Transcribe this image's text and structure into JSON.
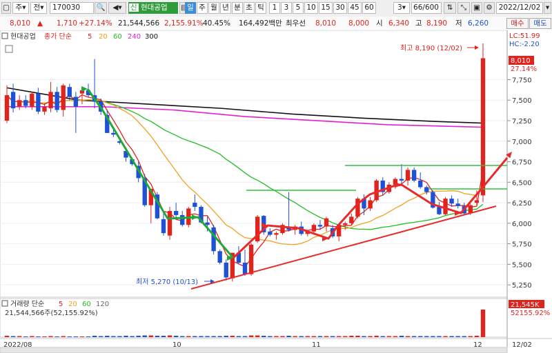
{
  "toolbar": {
    "period_label": "주",
    "all_label": "전",
    "code_value": "170030",
    "stock_name": "현대공업",
    "periods": [
      "일",
      "주",
      "월",
      "년",
      "분",
      "초",
      "틱"
    ],
    "intervals": [
      "1",
      "3",
      "5",
      "10",
      "15",
      "30",
      "45",
      "60"
    ],
    "interval_value": "3",
    "count_value": "66/600",
    "date_value": "2022/12/02"
  },
  "quote": {
    "price": "8,010",
    "arrow": "▲",
    "change": "1,710",
    "change_pct": "+27.14%",
    "volume": "21,544,566",
    "volume_ratio": "2,155.91%",
    "turnover_rate": "40.45%",
    "trade_value": "164,492백만",
    "best_ask_label": "최우선",
    "best_ask": "8,010",
    "best_bid": "8,000",
    "open_label": "시",
    "open": "6,340",
    "high_label": "고",
    "high": "8,190",
    "low_label": "저",
    "low": "6,260",
    "buy_label": "매수",
    "sell_label": "매도"
  },
  "price_legend": {
    "name": "현대공업",
    "type": "종가 단순",
    "ma": [
      {
        "label": "5",
        "color": "#e0231c"
      },
      {
        "label": "20",
        "color": "#f0a020"
      },
      {
        "label": "60",
        "color": "#1fbf1f"
      },
      {
        "label": "240",
        "color": "#e020d0"
      },
      {
        "label": "300",
        "color": "#111111"
      }
    ]
  },
  "corner": {
    "lc": "LC:51.99",
    "hc": "HC:-2.20"
  },
  "annotations": {
    "high": "최고 8,190 (12/02)",
    "low": "최저 5,270 (10/13)",
    "last_price": "8,010",
    "last_pct": "27.14%"
  },
  "volume_panel": {
    "title": "거래량 단순",
    "ma": [
      {
        "label": "5",
        "color": "#e0231c"
      },
      {
        "label": "20",
        "color": "#f0a020"
      },
      {
        "label": "60",
        "color": "#1fbf1f"
      },
      {
        "label": "120",
        "color": "#666666"
      }
    ],
    "current": "21,544,566주(52,155.92%)",
    "axis_value": "21,545K",
    "axis_pct": "52155.92%"
  },
  "x_axis": {
    "labels": [
      "2022/08",
      "10",
      "11",
      "12",
      "12/02"
    ]
  },
  "chart_data": {
    "type": "candlestick",
    "ylim": [
      5100,
      8350
    ],
    "y_ticks": [
      5250,
      5500,
      5750,
      6000,
      6250,
      6500,
      6750,
      7000,
      7250,
      7500,
      7750
    ],
    "y_tick_labels": [
      "5,250",
      "5,500",
      "5,750",
      "6,000",
      "6,250",
      "6,500",
      "6,750",
      "7,000",
      "7,250",
      "7,500",
      "7,750"
    ],
    "candles": [
      [
        7250,
        7680,
        7220,
        7560
      ],
      [
        7600,
        7700,
        7350,
        7400
      ],
      [
        7420,
        7560,
        7380,
        7500
      ],
      [
        7500,
        7560,
        7400,
        7430
      ],
      [
        7420,
        7600,
        7380,
        7580
      ],
      [
        7580,
        7650,
        7330,
        7360
      ],
      [
        7360,
        7460,
        7320,
        7420
      ],
      [
        7400,
        7720,
        7350,
        7600
      ],
      [
        7600,
        7660,
        7350,
        7380
      ],
      [
        7380,
        7700,
        7300,
        7680
      ],
      [
        7660,
        7700,
        7500,
        7540
      ],
      [
        7540,
        7600,
        7100,
        7420
      ],
      [
        7580,
        7650,
        7450,
        7620
      ],
      [
        7620,
        7700,
        7540,
        7560
      ],
      [
        7560,
        8000,
        7400,
        7480
      ],
      [
        7480,
        7520,
        7320,
        7360
      ],
      [
        7320,
        7380,
        7100,
        7100
      ],
      [
        7100,
        7150,
        7050,
        7080
      ],
      [
        7000,
        7040,
        6960,
        6980
      ],
      [
        6880,
        6900,
        6750,
        6800
      ],
      [
        6780,
        6800,
        6700,
        6720
      ],
      [
        6700,
        6750,
        6500,
        6550
      ],
      [
        6550,
        6600,
        6200,
        6220
      ],
      [
        6220,
        6400,
        6000,
        6420
      ],
      [
        6350,
        6380,
        6050,
        6060
      ],
      [
        6050,
        6120,
        5850,
        5880
      ],
      [
        5850,
        6200,
        5800,
        6150
      ],
      [
        6150,
        6250,
        6050,
        6100
      ],
      [
        6100,
        6150,
        5960,
        5980
      ],
      [
        5980,
        6200,
        5950,
        6180
      ],
      [
        6250,
        6350,
        6150,
        6200
      ],
      [
        6200,
        6220,
        6000,
        6010
      ],
      [
        6010,
        6080,
        5900,
        5980
      ],
      [
        5950,
        5980,
        5620,
        5660
      ],
      [
        5660,
        5680,
        5500,
        5520
      ],
      [
        5520,
        5560,
        5300,
        5340
      ],
      [
        5330,
        5640,
        5290,
        5640
      ],
      [
        5640,
        5720,
        5500,
        5520
      ],
      [
        5520,
        5680,
        5360,
        5380
      ],
      [
        5380,
        5760,
        5360,
        5740
      ],
      [
        5780,
        6100,
        5760,
        6080
      ],
      [
        6090,
        6100,
        5860,
        5890
      ],
      [
        5900,
        5940,
        5840,
        5860
      ],
      [
        5860,
        5900,
        5800,
        5880
      ],
      [
        5880,
        6000,
        5860,
        5980
      ],
      [
        5960,
        6380,
        5900,
        5920
      ],
      [
        5920,
        5980,
        5860,
        5960
      ],
      [
        5960,
        6020,
        5850,
        5870
      ],
      [
        5870,
        5920,
        5840,
        5900
      ],
      [
        5900,
        6000,
        5860,
        5980
      ],
      [
        5980,
        6040,
        5920,
        5960
      ],
      [
        5960,
        6080,
        5900,
        6060
      ],
      [
        5940,
        5980,
        5820,
        5840
      ],
      [
        5840,
        6000,
        5780,
        5980
      ],
      [
        5980,
        6020,
        5920,
        6000
      ],
      [
        6000,
        6120,
        5980,
        6080
      ],
      [
        6080,
        6320,
        6060,
        6300
      ],
      [
        6300,
        6350,
        6100,
        6180
      ],
      [
        6180,
        6320,
        6150,
        6280
      ],
      [
        6280,
        6540,
        6260,
        6520
      ],
      [
        6520,
        6560,
        6340,
        6380
      ],
      [
        6380,
        6500,
        6360,
        6470
      ],
      [
        6470,
        6560,
        6420,
        6540
      ],
      [
        6540,
        6720,
        6460,
        6520
      ],
      [
        6520,
        6680,
        6460,
        6650
      ],
      [
        6650,
        6680,
        6500,
        6520
      ],
      [
        6520,
        6620,
        6420,
        6440
      ],
      [
        6440,
        6460,
        6350,
        6380
      ],
      [
        6380,
        6400,
        6180,
        6190
      ],
      [
        6200,
        6260,
        6100,
        6110
      ],
      [
        6110,
        6320,
        6100,
        6300
      ],
      [
        6300,
        6340,
        6200,
        6240
      ],
      [
        6240,
        6300,
        6180,
        6210
      ],
      [
        6210,
        6250,
        6100,
        6120
      ],
      [
        6120,
        6240,
        6100,
        6220
      ],
      [
        6250,
        6400,
        6220,
        6280
      ],
      [
        6340,
        8190,
        6260,
        8010
      ]
    ],
    "volumes": [
      4,
      3,
      3,
      2,
      3,
      2,
      2,
      3,
      2,
      3,
      2,
      2,
      2,
      2,
      4,
      3,
      4,
      3,
      3,
      4,
      3,
      4,
      5,
      5,
      4,
      4,
      5,
      4,
      3,
      3,
      3,
      3,
      3,
      3,
      3,
      4,
      4,
      3,
      3,
      5,
      5,
      4,
      3,
      3,
      3,
      4,
      3,
      3,
      3,
      3,
      3,
      3,
      3,
      3,
      3,
      4,
      4,
      3,
      3,
      4,
      3,
      3,
      3,
      4,
      3,
      3,
      3,
      3,
      3,
      3,
      3,
      3,
      3,
      3,
      3,
      4,
      80
    ],
    "ma300": [
      [
        7650,
        0
      ],
      [
        7500,
        0.15
      ],
      [
        7450,
        0.3
      ],
      [
        7400,
        0.45
      ],
      [
        7330,
        0.6
      ],
      [
        7280,
        0.75
      ],
      [
        7240,
        0.9
      ],
      [
        7220,
        1
      ]
    ],
    "ma240": [
      [
        7420,
        0
      ],
      [
        7420,
        0.2
      ],
      [
        7380,
        0.35
      ],
      [
        7300,
        0.5
      ],
      [
        7250,
        0.65
      ],
      [
        7200,
        0.8
      ],
      [
        7170,
        1
      ]
    ]
  }
}
